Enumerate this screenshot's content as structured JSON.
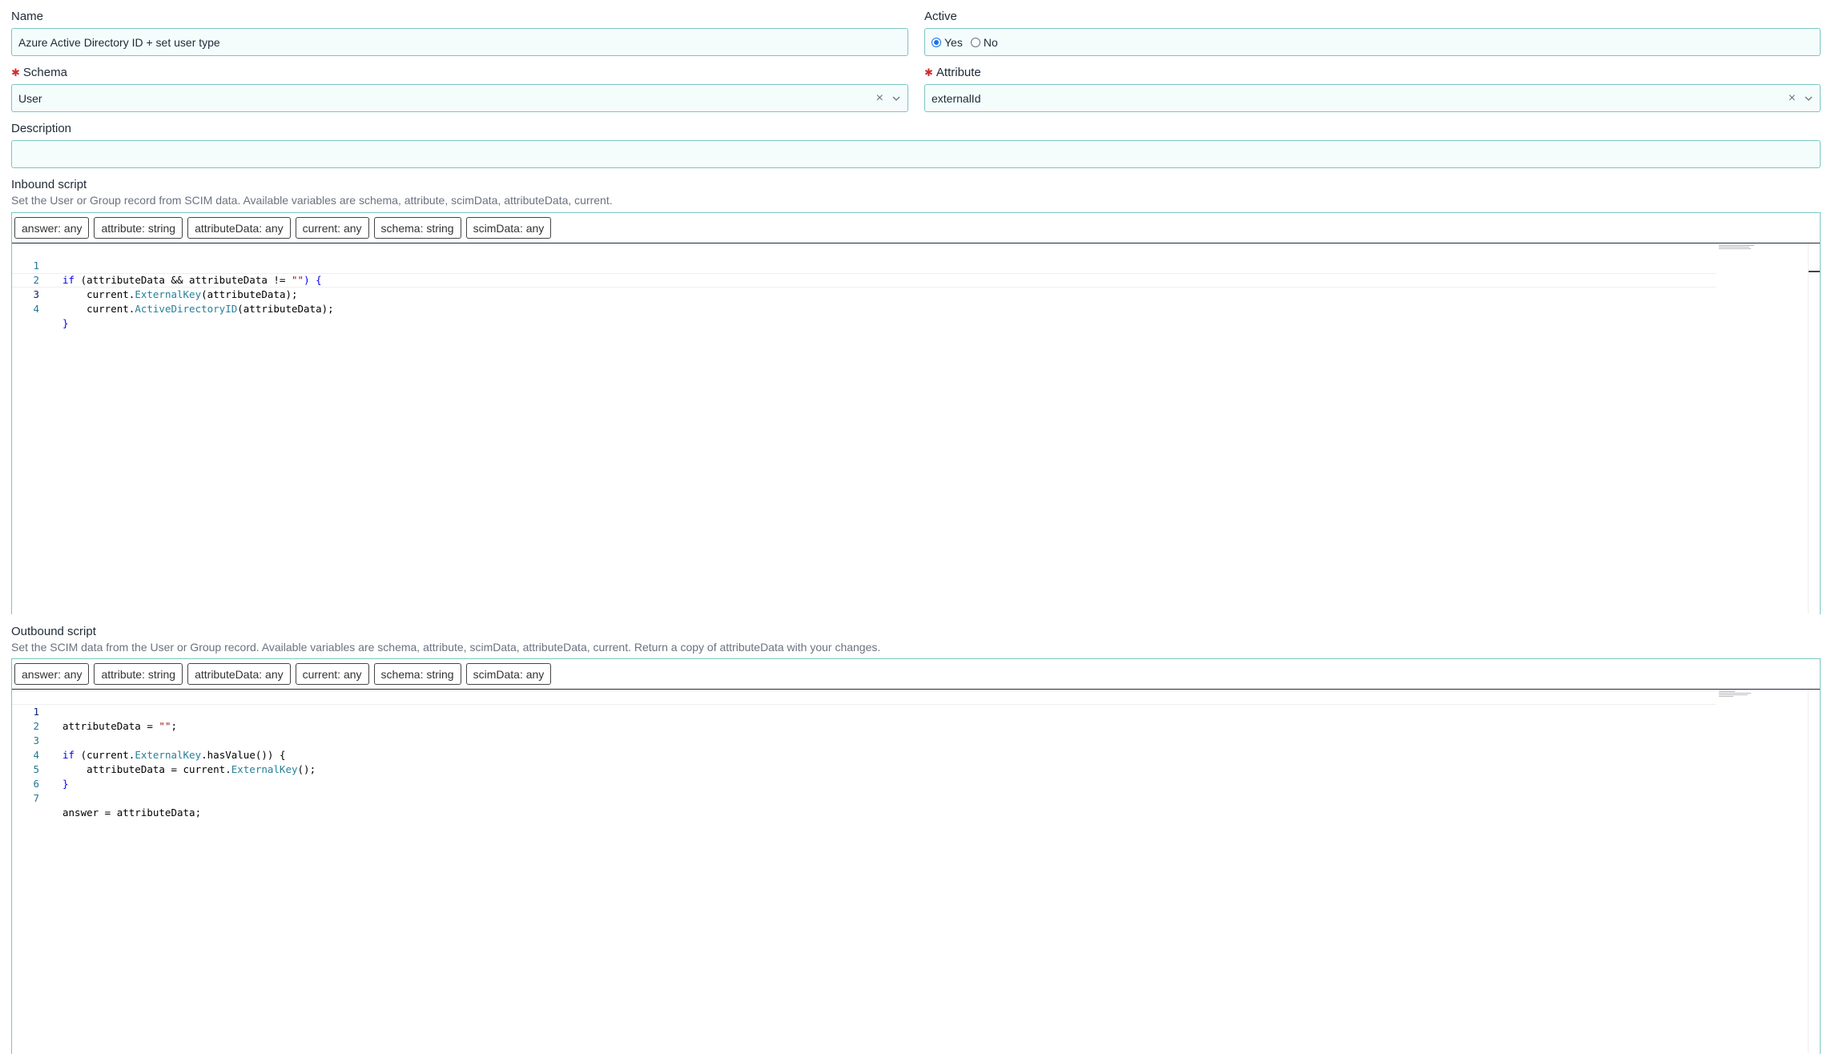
{
  "form": {
    "name_label": "Name",
    "name_value": "Azure Active Directory ID + set user type",
    "active_label": "Active",
    "active_yes": "Yes",
    "active_no": "No",
    "active_selected": "Yes",
    "schema_label": "Schema",
    "schema_value": "User",
    "attribute_label": "Attribute",
    "attribute_value": "externalId",
    "description_label": "Description",
    "description_value": ""
  },
  "inbound": {
    "label": "Inbound script",
    "help": "Set the User or Group record from SCIM data. Available variables are schema, attribute, scimData, attributeData, current.",
    "chips": [
      "answer: any",
      "attribute: string",
      "attributeData: any",
      "current: any",
      "schema: string",
      "scimData: any"
    ],
    "line_numbers": [
      "1",
      "2",
      "3",
      "4"
    ]
  },
  "outbound": {
    "label": "Outbound script",
    "help": "Set the SCIM data from the User or Group record. Available variables are schema, attribute, scimData, attributeData, current. Return a copy of attributeData with your changes.",
    "chips": [
      "answer: any",
      "attribute: string",
      "attributeData: any",
      "current: any",
      "schema: string",
      "scimData: any"
    ],
    "line_numbers": [
      "1",
      "2",
      "3",
      "4",
      "5",
      "6",
      "7"
    ]
  },
  "code": {
    "in1": {
      "kw": "if",
      "a": " (attributeData && attributeData != ",
      "s": "\"\"",
      "b": ") {"
    },
    "in2": {
      "a": "    current.",
      "f": "ExternalKey",
      "b": "(attributeData);"
    },
    "in3": {
      "a": "    current.",
      "f": "ActiveDirectoryID",
      "b": "(attributeData);"
    },
    "in4": {
      "a": "}"
    },
    "out1": {
      "a": "attributeData = ",
      "s": "\"\"",
      "b": ";"
    },
    "out3": {
      "kw": "if",
      "a": " (current.",
      "f": "ExternalKey",
      "b": ".hasValue()) {"
    },
    "out4": {
      "a": "    attributeData = current.",
      "f": "ExternalKey",
      "b": "();"
    },
    "out5": {
      "a": "}"
    },
    "out7": {
      "a": "answer = attributeData;"
    }
  },
  "icons": {
    "clear": "close-icon",
    "dropdown": "chevron-down-icon"
  },
  "colors": {
    "field_border": "#7cc5c3",
    "field_bg": "#f5fcfc",
    "required": "#d12c2c",
    "radio_selected": "#1a73e8",
    "line_number": "#237893",
    "keyword": "#0000ff",
    "string": "#a31515",
    "function": "#267f99"
  }
}
